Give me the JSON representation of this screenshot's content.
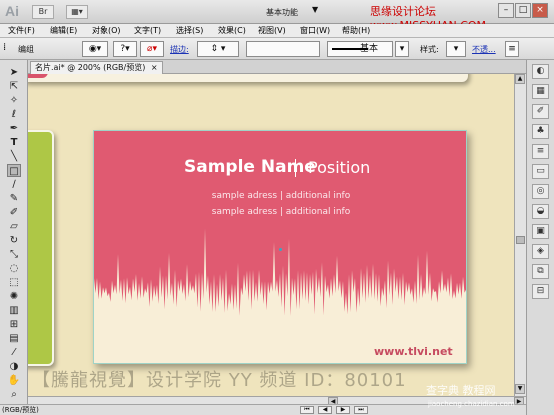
{
  "titlebar": {
    "app_logo": "Ai",
    "workspace_label": "基本功能",
    "watermark": "思缘设计论坛 www.MISSYUAN.COM",
    "minimize": "–",
    "restore": "□",
    "close": "×"
  },
  "menu": {
    "items": [
      "文件(F)",
      "编辑(E)",
      "对象(O)",
      "文字(T)",
      "选择(S)",
      "效果(C)",
      "视图(V)",
      "窗口(W)",
      "帮助(H)"
    ]
  },
  "control_bar": {
    "group_label": "编组",
    "stroke_label": "描边:",
    "style_preset": "基本",
    "style_label": "样式:",
    "opacity_link": "不透..."
  },
  "document": {
    "tab_title": "名片.ai* @ 200% (RGB/预览)",
    "status_text": "(RGB/预览)"
  },
  "card": {
    "name": "Sample Name",
    "position": "Position",
    "address_1": "sample adress | additional info",
    "address_2": "sample adress | additional info",
    "url": "www.tlvi.net",
    "colors": {
      "background": "#e05a71",
      "wave": "#f8eed7",
      "url": "#c64b60"
    }
  },
  "watermarks": {
    "bottom": "【騰龍視覺】设计学院 YY 频道 ID：80101",
    "site_name": "查字典 教程网",
    "site_url": "jiaocheng.chazidian.com"
  },
  "tools": [
    "selection-tool",
    "direct-selection-tool",
    "magic-wand-tool",
    "lasso-tool",
    "pen-tool",
    "type-tool",
    "line-tool",
    "rectangle-tool",
    "paintbrush-tool",
    "pencil-tool",
    "blob-brush-tool",
    "eraser-tool",
    "rotate-tool",
    "scale-tool",
    "warp-tool",
    "free-transform-tool",
    "symbol-sprayer-tool",
    "graph-tool",
    "mesh-tool",
    "gradient-tool",
    "eyedropper-tool",
    "blend-tool",
    "live-paint-tool",
    "artboard-tool",
    "slice-tool",
    "hand-tool",
    "zoom-tool"
  ],
  "right_panel": [
    "color-icon",
    "swatches-icon",
    "brushes-icon",
    "symbols-icon",
    "stroke-icon",
    "gradient-icon",
    "transparency-icon",
    "appearance-icon",
    "graphic-styles-icon",
    "layers-icon",
    "artboards-icon"
  ]
}
